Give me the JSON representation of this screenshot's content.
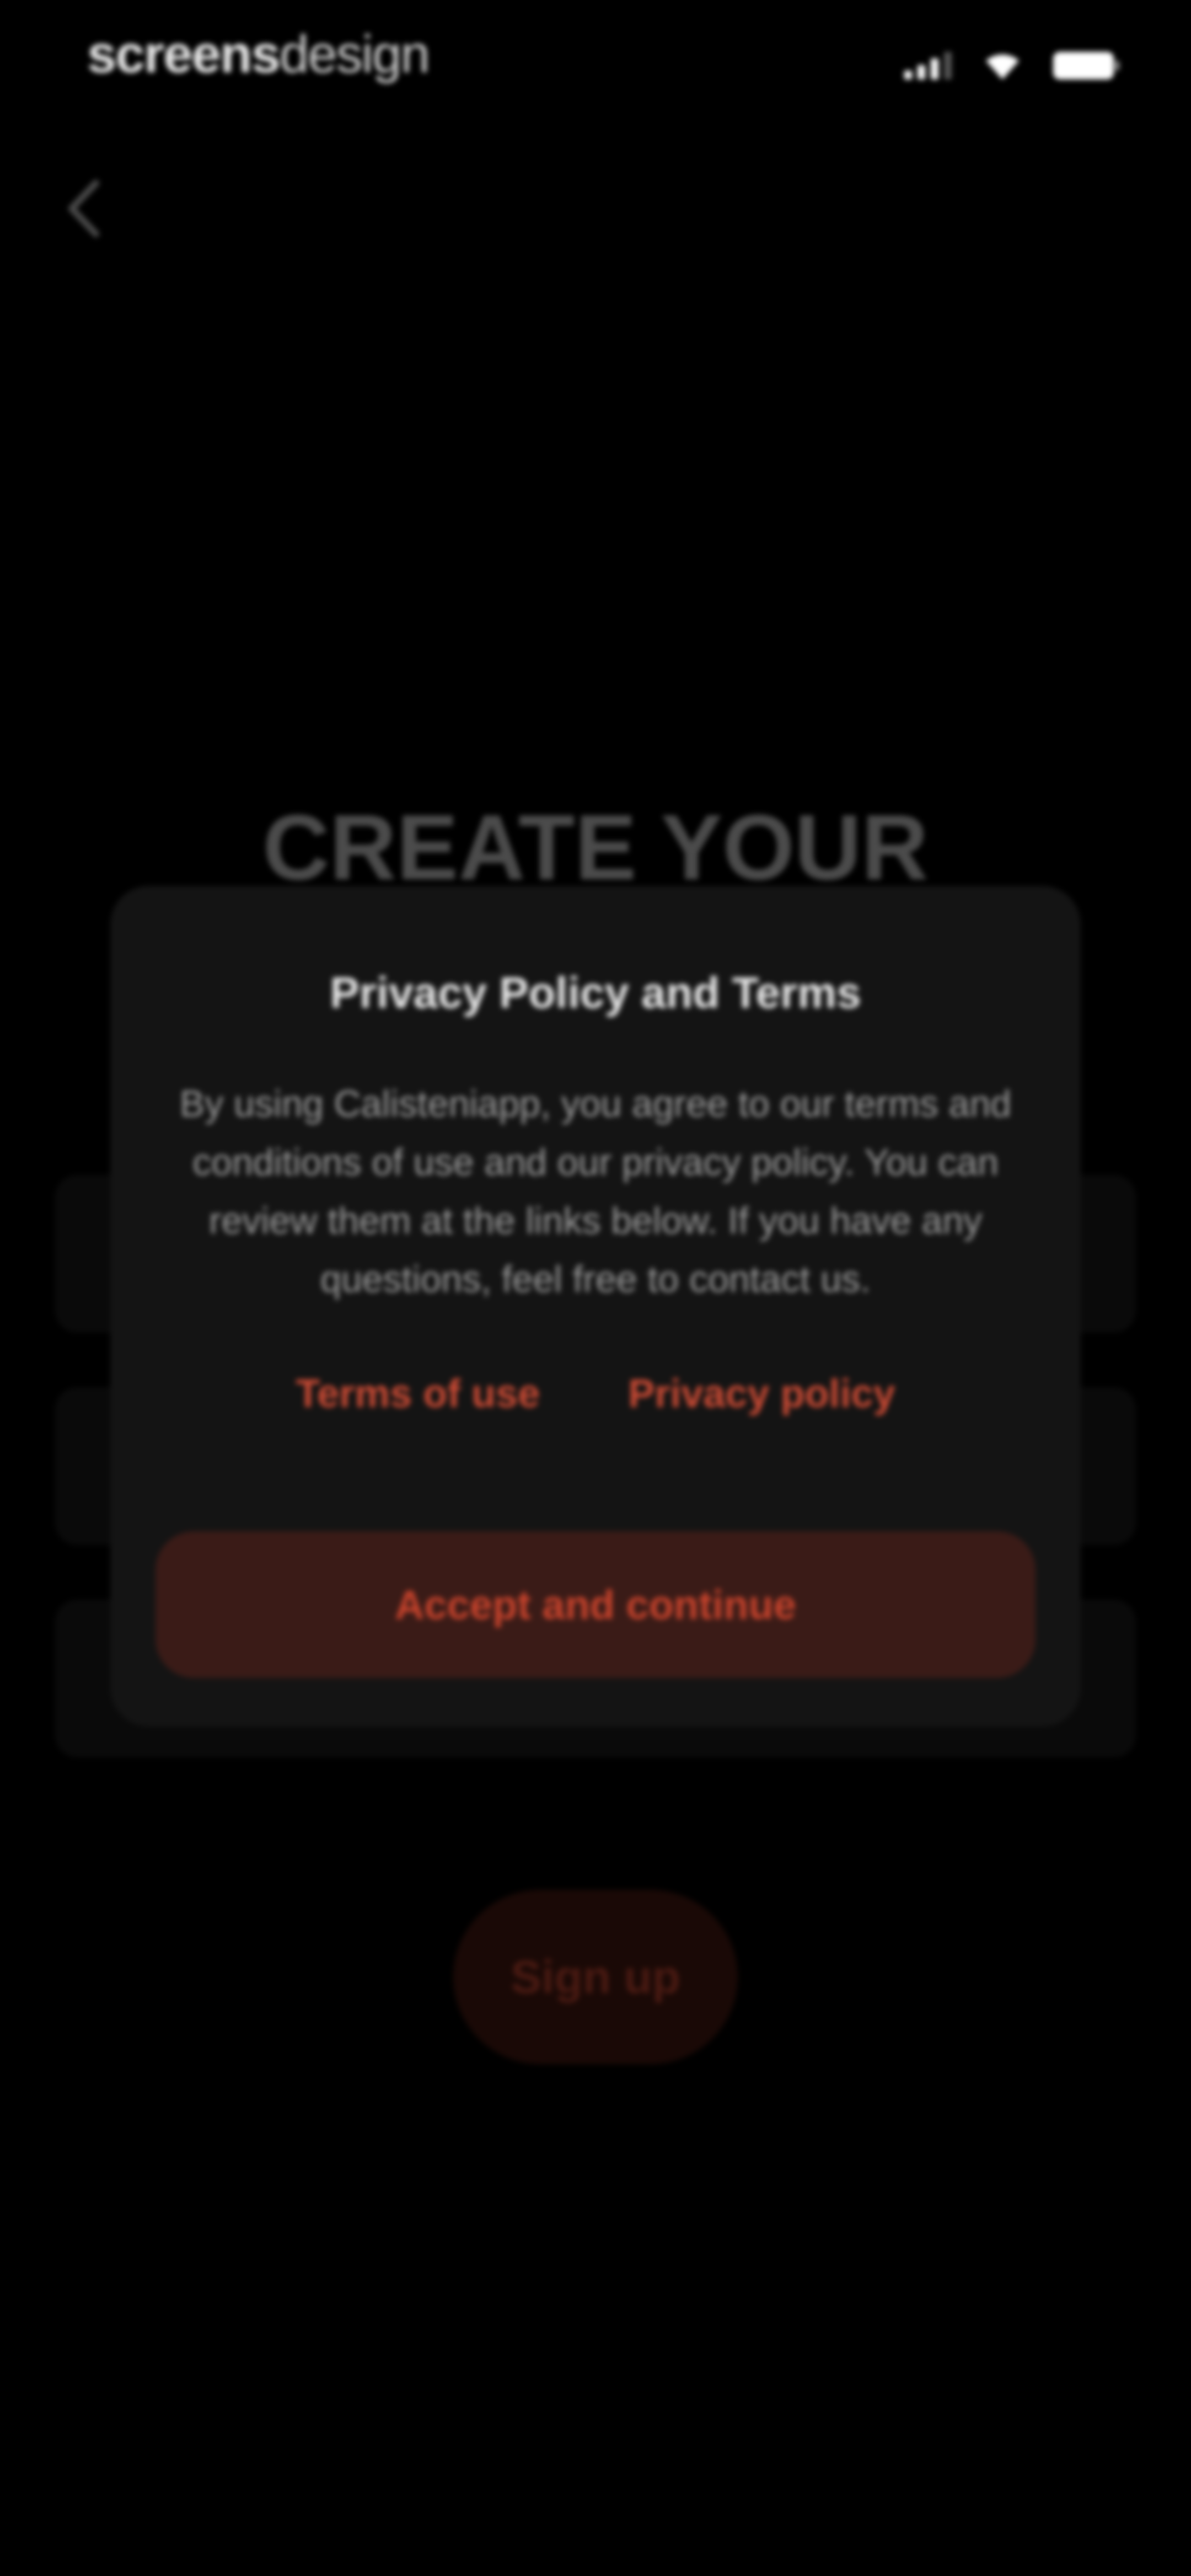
{
  "status_bar": {
    "brand_part1": "screens",
    "brand_part2": "design"
  },
  "background": {
    "heading": "CREATE YOUR",
    "signup_label": "Sign up"
  },
  "modal": {
    "title": "Privacy Policy and Terms",
    "body": "By using Calisteniapp, you agree to our terms and conditions of use and our privacy policy. You can review them at the links below. If you have any questions, feel free to contact us.",
    "terms_link": "Terms of use",
    "privacy_link": "Privacy policy",
    "accept_label": "Accept and continue"
  },
  "colors": {
    "accent": "#c94a34",
    "accept_bg": "#3a1b17",
    "modal_bg": "#141414",
    "background": "#000000"
  },
  "icons": {
    "back": "chevron-left-icon",
    "signal": "signal-icon",
    "wifi": "wifi-icon",
    "battery": "battery-icon"
  }
}
